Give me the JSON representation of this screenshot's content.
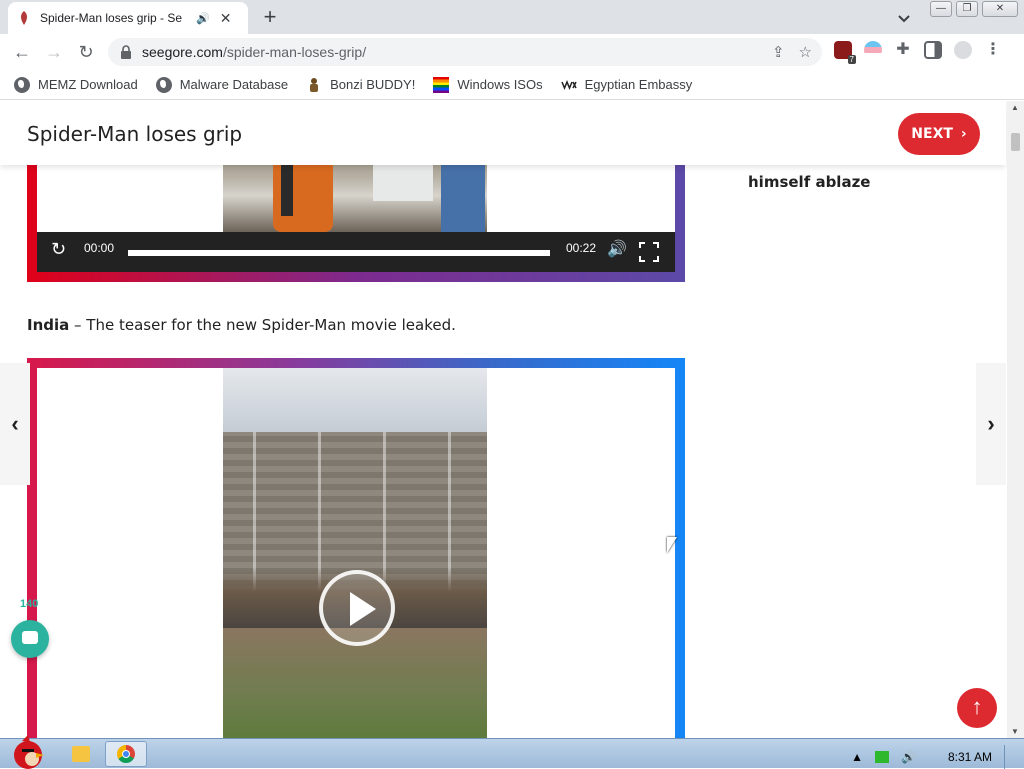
{
  "browser": {
    "tab_title": "Spider-Man loses grip - Se",
    "tab_audio_icon": "speaker-icon",
    "new_tab_label": "+",
    "url_host": "seegore.com",
    "url_path": "/spider-man-loses-grip/",
    "extension_badge": "7"
  },
  "bookmarks": [
    {
      "label": "MEMZ Download",
      "icon": "globe-icon"
    },
    {
      "label": "Malware Database",
      "icon": "globe-icon"
    },
    {
      "label": "Bonzi BUDDY!",
      "icon": "bonzi-icon"
    },
    {
      "label": "Windows ISOs",
      "icon": "rainbow-flag-icon"
    },
    {
      "label": "Egyptian Embassy",
      "icon": "wix-icon"
    }
  ],
  "site": {
    "title": "Spider-Man loses grip",
    "next_label": "NEXT",
    "sidebar_text": "himself ablaze"
  },
  "video1": {
    "current_time": "00:00",
    "duration": "00:22"
  },
  "caption": {
    "location": "India",
    "text": " – The teaser for the new Spider-Man movie leaked."
  },
  "comments": {
    "count": "140"
  },
  "taskbar": {
    "time": "8:31 AM"
  },
  "colors": {
    "accent": "#dd2a30",
    "comment": "#2bb3a0"
  }
}
